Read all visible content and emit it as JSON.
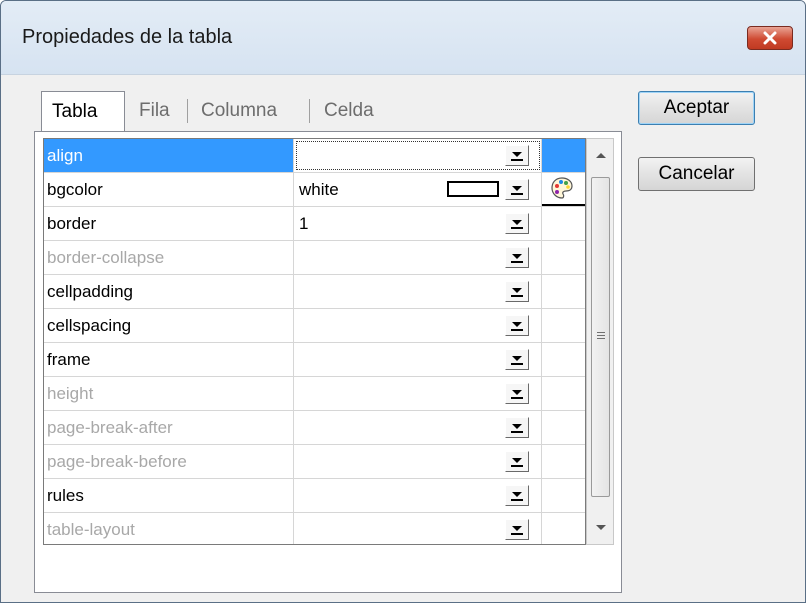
{
  "window": {
    "title": "Propiedades de la tabla"
  },
  "tabs": [
    {
      "label": "Tabla",
      "active": true
    },
    {
      "label": "Fila",
      "active": false
    },
    {
      "label": "Columna",
      "active": false
    },
    {
      "label": "Celda",
      "active": false
    }
  ],
  "properties": [
    {
      "name": "align",
      "value": "",
      "enabled": true,
      "selected": true
    },
    {
      "name": "bgcolor",
      "value": "white",
      "enabled": true,
      "selected": false,
      "color_swatch": "#ffffff",
      "icon": "color-palette-icon"
    },
    {
      "name": "border",
      "value": "1",
      "enabled": true,
      "selected": false
    },
    {
      "name": "border-collapse",
      "value": "",
      "enabled": false,
      "selected": false
    },
    {
      "name": "cellpadding",
      "value": "",
      "enabled": true,
      "selected": false
    },
    {
      "name": "cellspacing",
      "value": "",
      "enabled": true,
      "selected": false
    },
    {
      "name": "frame",
      "value": "",
      "enabled": true,
      "selected": false
    },
    {
      "name": "height",
      "value": "",
      "enabled": false,
      "selected": false
    },
    {
      "name": "page-break-after",
      "value": "",
      "enabled": false,
      "selected": false
    },
    {
      "name": "page-break-before",
      "value": "",
      "enabled": false,
      "selected": false
    },
    {
      "name": "rules",
      "value": "",
      "enabled": true,
      "selected": false
    },
    {
      "name": "table-layout",
      "value": "",
      "enabled": false,
      "selected": false
    }
  ],
  "buttons": {
    "ok": "Aceptar",
    "cancel": "Cancelar"
  },
  "colors": {
    "selection": "#3399ff",
    "disabled_text": "#a8a8a8",
    "close_button": "#cf4a32"
  }
}
